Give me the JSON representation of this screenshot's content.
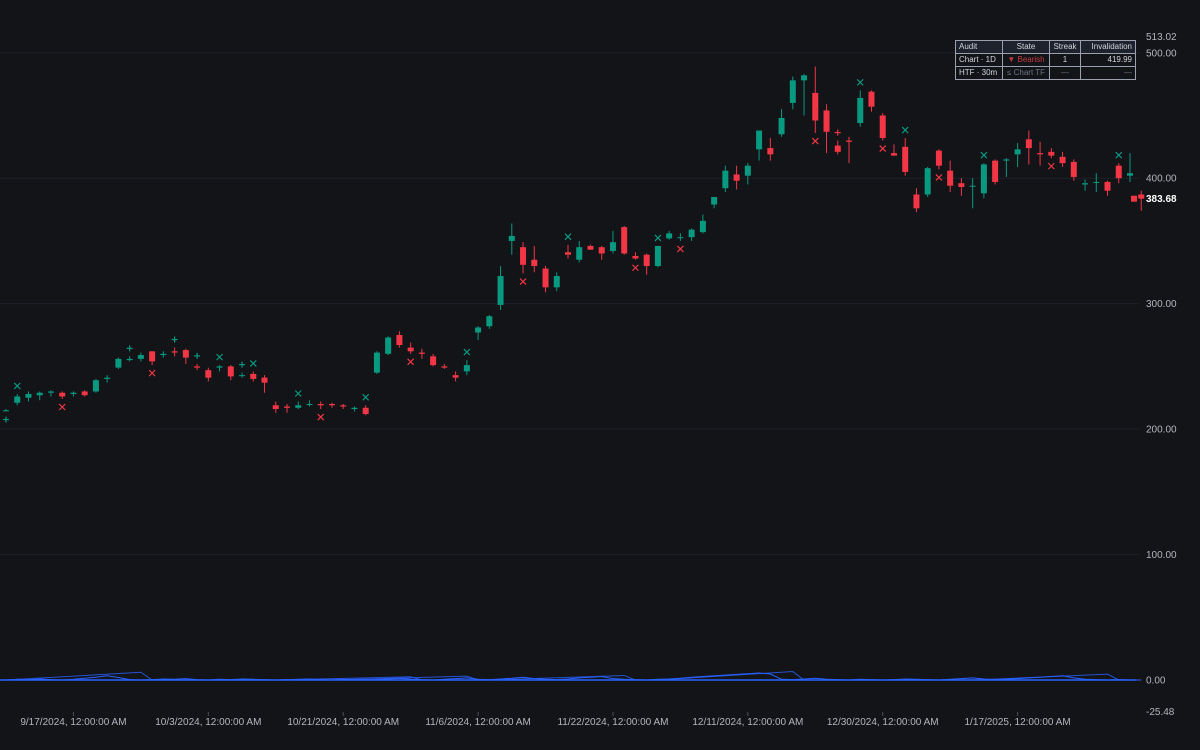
{
  "chart_data": {
    "type": "candlestick",
    "y_axis": {
      "range": [
        -25.48,
        513.02
      ],
      "ticks": [
        {
          "value": 500,
          "label": "500.00"
        },
        {
          "value": 400,
          "label": "400.00"
        },
        {
          "value": 300,
          "label": "300.00"
        },
        {
          "value": 200,
          "label": "200.00"
        },
        {
          "value": 100,
          "label": "100.00"
        },
        {
          "value": 0,
          "label": "0.00"
        }
      ],
      "max_label": "513.02",
      "min_label": "-25.48",
      "last_price": {
        "value": 383.68,
        "label": "383.68"
      }
    },
    "x_ticks": [
      {
        "label": "9/17/2024, 12:00:00 AM",
        "index": 6
      },
      {
        "label": "10/3/2024, 12:00:00 AM",
        "index": 18
      },
      {
        "label": "10/21/2024, 12:00:00 AM",
        "index": 30
      },
      {
        "label": "11/6/2024, 12:00:00 AM",
        "index": 42
      },
      {
        "label": "11/22/2024, 12:00:00 AM",
        "index": 54
      },
      {
        "label": "12/11/2024, 12:00:00 AM",
        "index": 66
      },
      {
        "label": "12/30/2024, 12:00:00 AM",
        "index": 78
      },
      {
        "label": "1/17/2025, 12:00:00 AM",
        "index": 90
      }
    ],
    "candles": [
      [
        215,
        216,
        214,
        215
      ],
      [
        221,
        228,
        219,
        226
      ],
      [
        225,
        230,
        222,
        228
      ],
      [
        227,
        230,
        223,
        229
      ],
      [
        229,
        231,
        226,
        230
      ],
      [
        229,
        230,
        224,
        226
      ],
      [
        228,
        230,
        226,
        229
      ],
      [
        230,
        231,
        226,
        227
      ],
      [
        230,
        240,
        229,
        239
      ],
      [
        240,
        243,
        237,
        241
      ],
      [
        249,
        257,
        248,
        256
      ],
      [
        255,
        258,
        254,
        256
      ],
      [
        256,
        261,
        254,
        259
      ],
      [
        262,
        262,
        251,
        254
      ],
      [
        259,
        262,
        257,
        260
      ],
      [
        262,
        265,
        258,
        261
      ],
      [
        263,
        264,
        252,
        257
      ],
      [
        250,
        252,
        247,
        249
      ],
      [
        247,
        249,
        238,
        241
      ],
      [
        249,
        251,
        246,
        250
      ],
      [
        250,
        251,
        239,
        242
      ],
      [
        243,
        245,
        241,
        243
      ],
      [
        244,
        246,
        238,
        240
      ],
      [
        241,
        243,
        229,
        237
      ],
      [
        219,
        222,
        213,
        216
      ],
      [
        218,
        220,
        213,
        217
      ],
      [
        217,
        222,
        216,
        219
      ],
      [
        220,
        223,
        218,
        220
      ],
      [
        220,
        222,
        216,
        219
      ],
      [
        220,
        221,
        217,
        219
      ],
      [
        219,
        220,
        216,
        218
      ],
      [
        216,
        218,
        214,
        217
      ],
      [
        217,
        219,
        211,
        212
      ],
      [
        245,
        262,
        244,
        261
      ],
      [
        260,
        274,
        259,
        273
      ],
      [
        275,
        278,
        265,
        267
      ],
      [
        265,
        269,
        260,
        262
      ],
      [
        261,
        264,
        256,
        260
      ],
      [
        258,
        260,
        250,
        251
      ],
      [
        250,
        252,
        248,
        249
      ],
      [
        243,
        246,
        238,
        241
      ],
      [
        246,
        255,
        243,
        251
      ],
      [
        277,
        282,
        271,
        281
      ],
      [
        282,
        291,
        280,
        290
      ],
      [
        299,
        330,
        295,
        322
      ],
      [
        350,
        364,
        339,
        354
      ],
      [
        345,
        349,
        324,
        331
      ],
      [
        335,
        346,
        325,
        330
      ],
      [
        328,
        330,
        309,
        313
      ],
      [
        313,
        325,
        310,
        322
      ],
      [
        341,
        347,
        336,
        339
      ],
      [
        335,
        350,
        333,
        345
      ],
      [
        346,
        347,
        343,
        343
      ],
      [
        345,
        346,
        335,
        340
      ],
      [
        342,
        358,
        340,
        349
      ],
      [
        361,
        362,
        339,
        340
      ],
      [
        338,
        341,
        335,
        336
      ],
      [
        339,
        340,
        323,
        330
      ],
      [
        330,
        346,
        329,
        346
      ],
      [
        352,
        358,
        351,
        356
      ],
      [
        353,
        356,
        350,
        353
      ],
      [
        353,
        360,
        350,
        359
      ],
      [
        357,
        371,
        356,
        366
      ],
      [
        379,
        385,
        376,
        385
      ],
      [
        392,
        410,
        389,
        406
      ],
      [
        403,
        410,
        391,
        398
      ],
      [
        402,
        412,
        395,
        410
      ],
      [
        423,
        427,
        414,
        438
      ],
      [
        424,
        432,
        414,
        419
      ],
      [
        435,
        455,
        433,
        448
      ],
      [
        460,
        481,
        455,
        478
      ],
      [
        478,
        483,
        450,
        482
      ],
      [
        468,
        489,
        436,
        446
      ],
      [
        454,
        459,
        420,
        437
      ],
      [
        426,
        430,
        419,
        421
      ],
      [
        430,
        433,
        412,
        429
      ],
      [
        444,
        470,
        441,
        464
      ],
      [
        469,
        470,
        453,
        457
      ],
      [
        450,
        452,
        430,
        432
      ],
      [
        420,
        427,
        418,
        418
      ],
      [
        425,
        432,
        402,
        405
      ],
      [
        387,
        392,
        373,
        376
      ],
      [
        387,
        409,
        385,
        408
      ],
      [
        422,
        423,
        407,
        410
      ],
      [
        406,
        414,
        389,
        394
      ],
      [
        396,
        400,
        386,
        393
      ],
      [
        394,
        400,
        376,
        394
      ],
      [
        388,
        412,
        384,
        411
      ],
      [
        414,
        415,
        395,
        397
      ],
      [
        414,
        416,
        401,
        415
      ],
      [
        419,
        428,
        409,
        423
      ],
      [
        431,
        438,
        411,
        424
      ],
      [
        420,
        429,
        410,
        419
      ],
      [
        421,
        424,
        416,
        418
      ],
      [
        417,
        421,
        409,
        412
      ],
      [
        413,
        415,
        398,
        401
      ],
      [
        395,
        399,
        390,
        396
      ],
      [
        397,
        404,
        389,
        397
      ],
      [
        397,
        398,
        386,
        390
      ],
      [
        410,
        412,
        396,
        400
      ],
      [
        402,
        420,
        397,
        404
      ],
      [
        387,
        390,
        374,
        383.68
      ]
    ],
    "markers": [
      {
        "index": 0,
        "shape": "plus",
        "side": "below",
        "color": "bull"
      },
      {
        "index": 1,
        "shape": "x",
        "side": "above",
        "color": "bull"
      },
      {
        "index": 5,
        "shape": "x",
        "side": "below",
        "color": "bear"
      },
      {
        "index": 11,
        "shape": "plus",
        "side": "above",
        "color": "bull"
      },
      {
        "index": 13,
        "shape": "x",
        "side": "below",
        "color": "bear"
      },
      {
        "index": 15,
        "shape": "plus",
        "side": "above",
        "color": "bull"
      },
      {
        "index": 17,
        "shape": "plus",
        "side": "above",
        "color": "bull"
      },
      {
        "index": 19,
        "shape": "x",
        "side": "above",
        "color": "bull"
      },
      {
        "index": 21,
        "shape": "plus",
        "side": "above",
        "color": "bull"
      },
      {
        "index": 22,
        "shape": "x",
        "side": "above",
        "color": "bull"
      },
      {
        "index": 26,
        "shape": "x",
        "side": "above",
        "color": "bull"
      },
      {
        "index": 28,
        "shape": "x",
        "side": "below",
        "color": "bear"
      },
      {
        "index": 32,
        "shape": "x",
        "side": "above",
        "color": "bull"
      },
      {
        "index": 36,
        "shape": "x",
        "side": "below",
        "color": "bear"
      },
      {
        "index": 41,
        "shape": "x",
        "side": "above",
        "color": "bull"
      },
      {
        "index": 46,
        "shape": "x",
        "side": "below",
        "color": "bear"
      },
      {
        "index": 50,
        "shape": "x",
        "side": "above",
        "color": "bull"
      },
      {
        "index": 56,
        "shape": "x",
        "side": "below",
        "color": "bear"
      },
      {
        "index": 58,
        "shape": "x",
        "side": "above",
        "color": "bull"
      },
      {
        "index": 60,
        "shape": "x",
        "side": "below",
        "color": "bear"
      },
      {
        "index": 72,
        "shape": "x",
        "side": "below",
        "color": "bear"
      },
      {
        "index": 74,
        "shape": "plus",
        "side": "above",
        "color": "bear"
      },
      {
        "index": 76,
        "shape": "x",
        "side": "above",
        "color": "bull"
      },
      {
        "index": 78,
        "shape": "x",
        "side": "below",
        "color": "bear"
      },
      {
        "index": 80,
        "shape": "x",
        "side": "above",
        "color": "bull"
      },
      {
        "index": 83,
        "shape": "x",
        "side": "below",
        "color": "bear"
      },
      {
        "index": 87,
        "shape": "x",
        "side": "above",
        "color": "bull"
      },
      {
        "index": 93,
        "shape": "x",
        "side": "below",
        "color": "bear"
      },
      {
        "index": 99,
        "shape": "x",
        "side": "above",
        "color": "bull"
      }
    ],
    "indicator": {
      "baseline": 0,
      "values": [
        0,
        2,
        1,
        3,
        1,
        0,
        2,
        5,
        8,
        12,
        7,
        1,
        0,
        1,
        3,
        2,
        4,
        1,
        0,
        2,
        1,
        3,
        2,
        1,
        0,
        1,
        2,
        3,
        1,
        0,
        2,
        1,
        0,
        1,
        3,
        5,
        2,
        1,
        0,
        2,
        4,
        6,
        2,
        1,
        3,
        5,
        8,
        4,
        2,
        1,
        3,
        6,
        8,
        10,
        4,
        2,
        1,
        0,
        2,
        3,
        5,
        8,
        10,
        12,
        14,
        16,
        18,
        20,
        17,
        2,
        1,
        3,
        5,
        2,
        1,
        0,
        2,
        1,
        0,
        1,
        3,
        2,
        1,
        0,
        2,
        4,
        6,
        3,
        1,
        2,
        4,
        6,
        8,
        10,
        12,
        6,
        2,
        1,
        0,
        1,
        0,
        0
      ],
      "spikes": [
        {
          "index": 12,
          "value": 12
        },
        {
          "index": 36,
          "value": 5
        },
        {
          "index": 41,
          "value": 6
        },
        {
          "index": 55,
          "value": 7
        },
        {
          "index": 70,
          "value": 13
        },
        {
          "index": 98,
          "value": 9
        }
      ]
    }
  },
  "audit_table": {
    "headers": [
      "Audit",
      "State",
      "Streak",
      "Invalidation"
    ],
    "rows": [
      {
        "audit": "Chart · 1D",
        "state": "▼ Bearish",
        "streak": "1",
        "invalidation": "419.99"
      },
      {
        "audit": "HTF · 30m",
        "state": "≤ Chart TF",
        "streak": "—",
        "invalidation": "—"
      }
    ]
  },
  "colors": {
    "background": "#131417",
    "bull": "#089981",
    "bear": "#f23645",
    "indicator": "#2962ff",
    "axis_text": "#b2b5be",
    "grid": "#1e2028"
  }
}
